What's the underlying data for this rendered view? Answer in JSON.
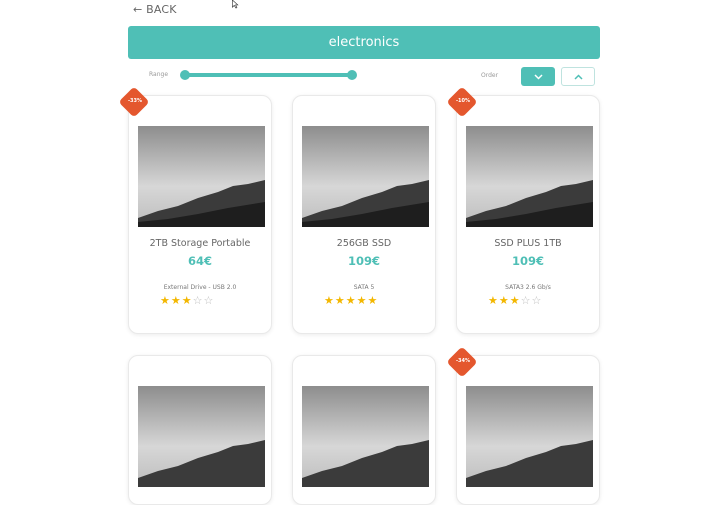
{
  "nav": {
    "back_label": "← BACK"
  },
  "banner": {
    "title": "electronics"
  },
  "filters": {
    "range_label": "Range",
    "order_label": "Order",
    "range_min_fraction": 0.0,
    "range_max_fraction": 1.0
  },
  "colors": {
    "accent": "#4fbfb6",
    "badge": "#e4572e",
    "star": "#f3b700"
  },
  "products": [
    {
      "badge": "-33%",
      "title": "2TB Storage Portable",
      "price": "64€",
      "desc": "External Drive - USB 2.0",
      "rating": 3
    },
    {
      "badge": "",
      "title": "256GB SSD",
      "price": "109€",
      "desc": "SATA 5",
      "rating": 5
    },
    {
      "badge": "-10%",
      "title": "SSD PLUS 1TB",
      "price": "109€",
      "desc": "SATA3 2.6 Gb/s",
      "rating": 3
    },
    {
      "badge": "",
      "title": "",
      "price": "",
      "desc": "",
      "rating": 0
    },
    {
      "badge": "",
      "title": "",
      "price": "",
      "desc": "",
      "rating": 0
    },
    {
      "badge": "-34%",
      "title": "",
      "price": "",
      "desc": "",
      "rating": 0
    }
  ]
}
